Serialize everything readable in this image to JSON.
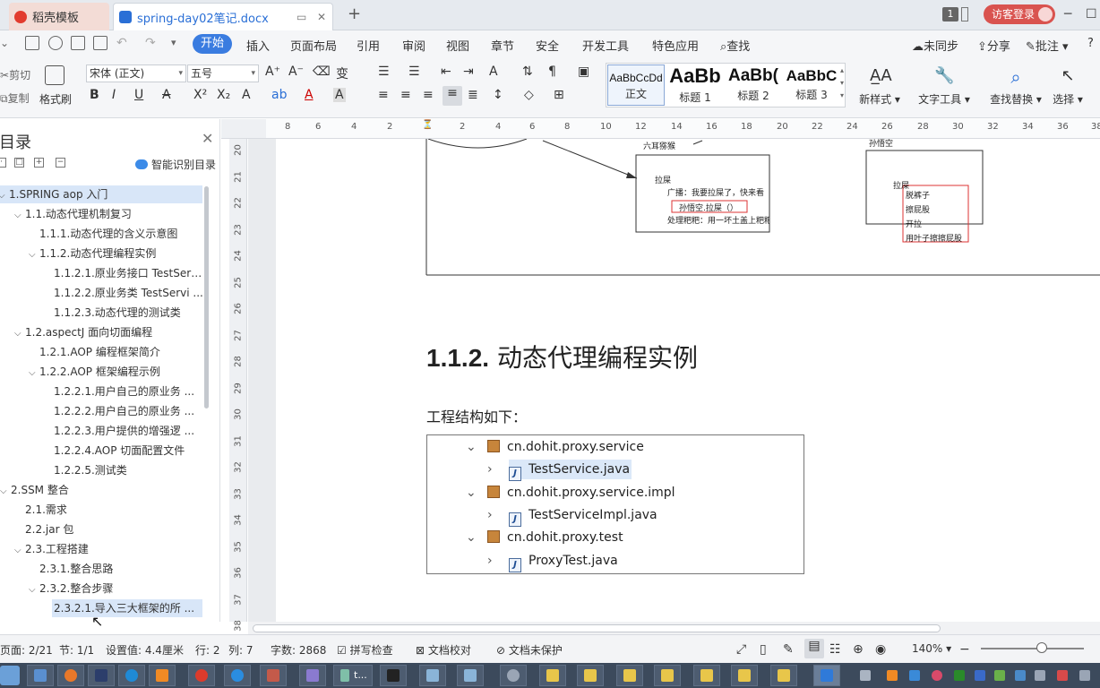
{
  "tabs": {
    "tab1_title": "稻壳模板",
    "tab2_title": "spring-day02笔记.docx",
    "page_badge": "1",
    "login_label": "访客登录"
  },
  "menu": {
    "items": [
      "开始",
      "插入",
      "页面布局",
      "引用",
      "审阅",
      "视图",
      "章节",
      "安全",
      "开发工具",
      "特色应用",
      "查找"
    ],
    "right": [
      "未同步",
      "分享",
      "批注"
    ]
  },
  "ribbon": {
    "cut": "剪切",
    "copy": "复制",
    "format_painter": "格式刷",
    "font_name": "宋体 (正文)",
    "font_size": "五号",
    "styles": [
      {
        "preview": "AaBbCcDd",
        "name": "正文"
      },
      {
        "preview": "AaBb",
        "name": "标题 1"
      },
      {
        "preview": "AaBb(",
        "name": "标题 2"
      },
      {
        "preview": "AaBbC",
        "name": "标题 3"
      }
    ],
    "new_style": "新样式",
    "text_tool": "文字工具",
    "find_replace": "查找替换",
    "select": "选择"
  },
  "toc": {
    "title": "目录",
    "smart_label": "智能识别目录",
    "items": [
      {
        "text": "1.SPRING aop 入门",
        "level": 0,
        "chev": "⌵",
        "highlight": true
      },
      {
        "text": "1.1.动态代理机制复习",
        "level": 1,
        "chev": "⌵"
      },
      {
        "text": "1.1.1.动态代理的含义示意图",
        "level": 2,
        "chev": ""
      },
      {
        "text": "1.1.2.动态代理编程实例",
        "level": 2,
        "chev": "⌵"
      },
      {
        "text": "1.1.2.1.原业务接口 TestSer ...",
        "level": 3,
        "chev": ""
      },
      {
        "text": "1.1.2.2.原业务类 TestServi ...",
        "level": 3,
        "chev": ""
      },
      {
        "text": "1.1.2.3.动态代理的测试类",
        "level": 3,
        "chev": ""
      },
      {
        "text": "1.2.aspectJ 面向切面编程",
        "level": 1,
        "chev": "⌵"
      },
      {
        "text": "1.2.1.AOP 编程框架简介",
        "level": 2,
        "chev": ""
      },
      {
        "text": "1.2.2.AOP 框架编程示例",
        "level": 2,
        "chev": "⌵"
      },
      {
        "text": "1.2.2.1.用户自己的原业务 ...",
        "level": 3,
        "chev": ""
      },
      {
        "text": "1.2.2.2.用户自己的原业务 ...",
        "level": 3,
        "chev": ""
      },
      {
        "text": "1.2.2.3.用户提供的增强逻 ...",
        "level": 3,
        "chev": ""
      },
      {
        "text": "1.2.2.4.AOP 切面配置文件",
        "level": 3,
        "chev": ""
      },
      {
        "text": "1.2.2.5.测试类",
        "level": 3,
        "chev": ""
      },
      {
        "text": "2.SSM 整合",
        "level": 0,
        "chev": "⌵"
      },
      {
        "text": "2.1.需求",
        "level": 1,
        "chev": ""
      },
      {
        "text": "2.2.jar 包",
        "level": 1,
        "chev": ""
      },
      {
        "text": "2.3.工程搭建",
        "level": 1,
        "chev": "⌵"
      },
      {
        "text": "2.3.1.整合思路",
        "level": 2,
        "chev": ""
      },
      {
        "text": "2.3.2.整合步骤",
        "level": 2,
        "chev": "⌵"
      },
      {
        "text": "2.3.2.1.导入三大框架的所 ...",
        "level": 3,
        "chev": "",
        "highlight": true
      }
    ]
  },
  "ruler": {
    "h": [
      "8",
      "6",
      "4",
      "2",
      "2",
      "4",
      "6",
      "8",
      "10",
      "12",
      "14",
      "16",
      "18",
      "20",
      "22",
      "24",
      "26",
      "28",
      "30",
      "32",
      "34",
      "36",
      "38"
    ],
    "v": [
      "20",
      "21",
      "22",
      "23",
      "24",
      "25",
      "26",
      "27",
      "28",
      "29",
      "30",
      "31",
      "32",
      "33",
      "34",
      "35",
      "36",
      "37",
      "38"
    ]
  },
  "diagram": {
    "top_label_left": "六耳猕猴",
    "top_label_right": "孙悟空",
    "left_box": [
      "拉屎",
      "广播：我要拉屎了，快来看",
      "孙悟空.拉屎（）",
      "处理粑粑：用一坏土盖上粑粑"
    ],
    "right_box": [
      "拉屎",
      "脱裤子",
      "擦屁股",
      "开拉",
      "用叶子擦擦屁股"
    ]
  },
  "document": {
    "heading_num": "1.1.2.",
    "heading_text": "动态代理编程实例",
    "para": "工程结构如下：",
    "tree": [
      {
        "text": "cn.dohit.proxy.service",
        "kind": "package",
        "chev": "⌄"
      },
      {
        "text": "TestService.java",
        "kind": "interface",
        "chev": "›"
      },
      {
        "text": "cn.dohit.proxy.service.impl",
        "kind": "package",
        "chev": "⌄"
      },
      {
        "text": "TestServiceImpl.java",
        "kind": "java",
        "chev": "›"
      },
      {
        "text": "cn.dohit.proxy.test",
        "kind": "package",
        "chev": "⌄"
      },
      {
        "text": "ProxyTest.java",
        "kind": "java",
        "chev": "›"
      }
    ]
  },
  "status": {
    "page": "页面: 2/21",
    "section": "节: 1/1",
    "setting": "设置值: 4.4厘米",
    "row": "行: 2",
    "col": "列: 7",
    "words": "字数: 2868",
    "spell": "拼写检查",
    "proof": "文档校对",
    "protect": "文档未保护",
    "zoom": "140%",
    "zoom_level": 0.59
  },
  "taskbar": {
    "tk_label": "t..."
  }
}
